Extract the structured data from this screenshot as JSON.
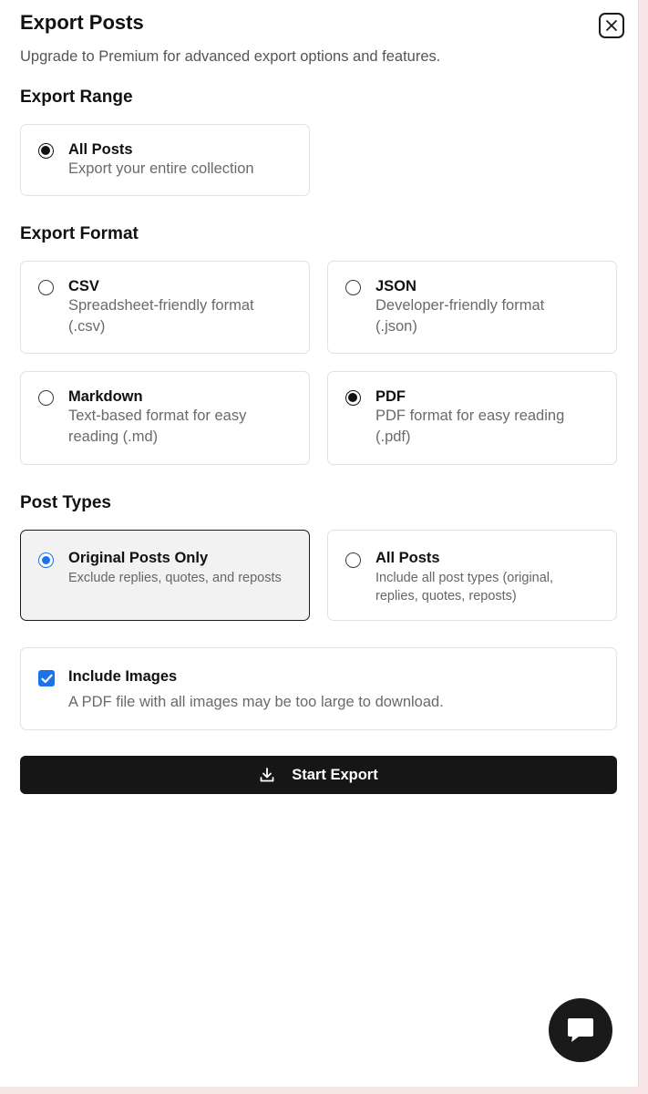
{
  "dialog": {
    "title": "Export Posts",
    "subtitle": "Upgrade to Premium for advanced export options and features."
  },
  "range": {
    "heading": "Export Range",
    "options": [
      {
        "label": "All Posts",
        "description": "Export your entire collection",
        "selected": true
      }
    ]
  },
  "format": {
    "heading": "Export Format",
    "options": [
      {
        "label": "CSV",
        "description_1": "Spreadsheet-friendly format",
        "description_2": "(.csv)",
        "selected": false
      },
      {
        "label": "JSON",
        "description_1": "Developer-friendly format",
        "description_2": "(.json)",
        "selected": false
      },
      {
        "label": "Markdown",
        "description_1": "Text-based format for easy",
        "description_2": "reading (.md)",
        "selected": false
      },
      {
        "label": "PDF",
        "description_1": "PDF format for easy reading",
        "description_2": "(.pdf)",
        "selected": true
      }
    ]
  },
  "post_types": {
    "heading": "Post Types",
    "options": [
      {
        "label": "Original Posts Only",
        "description_1": "Exclude replies, quotes, and reposts",
        "description_2": "",
        "selected": true
      },
      {
        "label": "All Posts",
        "description_1": "Include all post types (original,",
        "description_2": "replies, quotes, reposts)",
        "selected": false
      }
    ]
  },
  "images": {
    "label": "Include Images",
    "note": "A PDF file with all images may be too large to download.",
    "checked": true
  },
  "actions": {
    "start_label": "Start Export"
  },
  "icons": {
    "close": "close-icon",
    "download": "download-icon",
    "chat": "chat-icon",
    "check": "check-icon"
  },
  "colors": {
    "accent": "#1a73e8",
    "primary_button": "#161616",
    "background": "#f6e6e8"
  }
}
